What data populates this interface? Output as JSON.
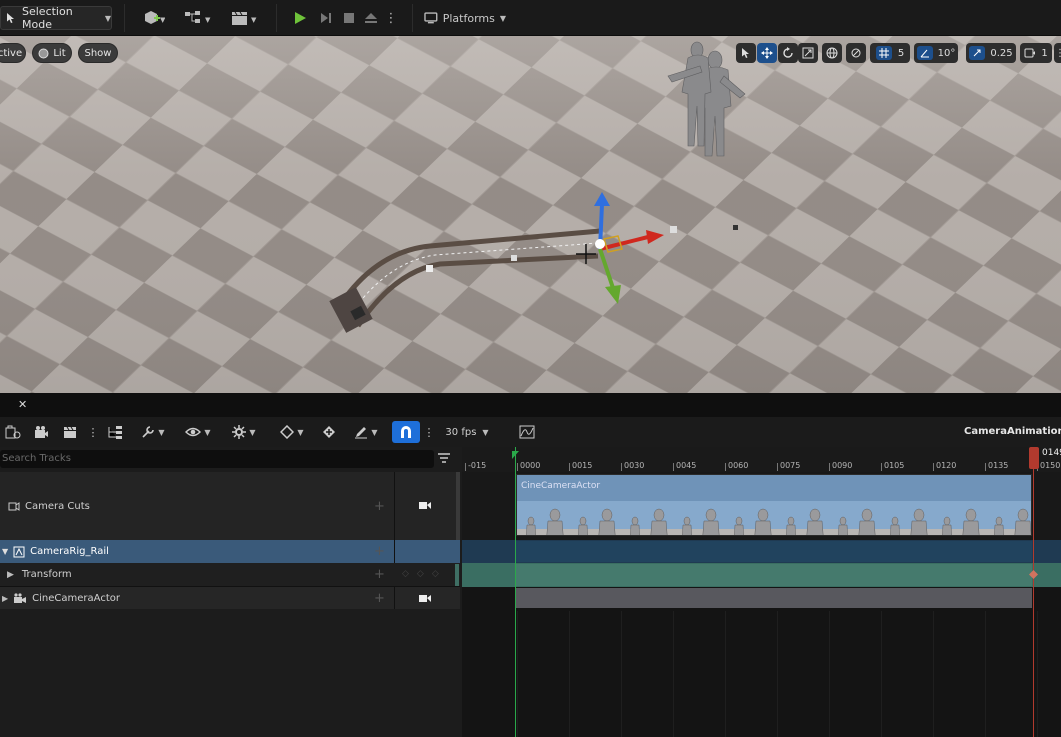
{
  "toolbar": {
    "selection_mode": "Selection Mode",
    "platforms": "Platforms"
  },
  "viewport": {
    "perspective_label": "ctive",
    "lit_label": "Lit",
    "show_label": "Show",
    "grid_snap_value": "5",
    "rotation_snap_value": "10°",
    "scale_snap_value": "0.25",
    "camera_speed_value": "1"
  },
  "sequencer": {
    "fps_label": "30 fps",
    "sequence_name": "CameraAnimation",
    "search_placeholder": "Search Tracks",
    "playhead_frame": "0149",
    "tracks": [
      {
        "label": "Camera Cuts"
      },
      {
        "label": "CameraRig_Rail"
      },
      {
        "label": "Transform"
      },
      {
        "label": "CineCameraActor"
      }
    ],
    "ruler_labels": [
      "-015",
      "0000",
      "0015",
      "0030",
      "0045",
      "0060",
      "0075",
      "0090",
      "0105",
      "0120",
      "0135",
      "0150"
    ],
    "section_label": "CineCameraActor"
  },
  "colors": {
    "accent_blue": "#1e6fd9",
    "selected_row": "#3a5a7a",
    "transform_section": "#3f6f64",
    "playhead": "#b23a2e",
    "start_marker": "#2aa84a"
  }
}
